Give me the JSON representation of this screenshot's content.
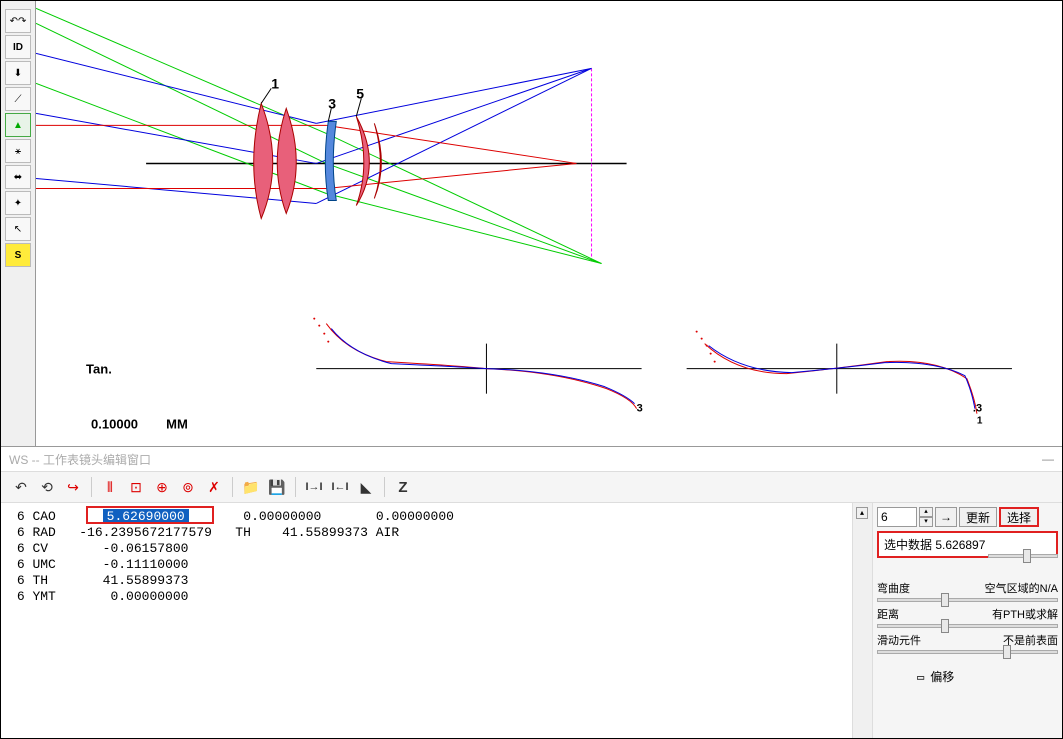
{
  "top_toolbar": {
    "icons": [
      "↶↷",
      "ID",
      "⬇",
      "⟋",
      "▲",
      "⚹",
      "⬌",
      "✦",
      "↖",
      "S"
    ]
  },
  "diagram": {
    "labels": {
      "lens1": "1",
      "lens3": "3",
      "lens5": "5"
    },
    "tan_label": "Tan.",
    "scale": "0.10000",
    "unit": "MM",
    "curve_label_right": "3",
    "curve_label_right2": ".3",
    "curve_label_right3": "1"
  },
  "ws_title": "WS -- 工作表镜头编辑窗口",
  "ws_toolbar_icons": [
    "↶",
    "⟲",
    "↪",
    "⫴",
    "⊡",
    "⊕",
    "⊚",
    "✗",
    "",
    "📁",
    "💾",
    "",
    "I→I",
    "I←I",
    "◣",
    "",
    "Z"
  ],
  "data_rows": [
    {
      "n": "6",
      "key": "CAO",
      "v1_hl": "5.62690000",
      "v2": "0.00000000",
      "v3": "0.00000000"
    },
    {
      "n": "6",
      "key": "RAD",
      "v1": "-16.2395672177579",
      "mid": "TH",
      "v2": "41.55899373",
      "v3": "AIR"
    },
    {
      "n": "6",
      "key": "CV",
      "v1": "-0.06157800"
    },
    {
      "n": "6",
      "key": "UMC",
      "v1": "-0.11110000"
    },
    {
      "n": "6",
      "key": "TH",
      "v1": "41.55899373"
    },
    {
      "n": "6",
      "key": "YMT",
      "v1": "0.00000000"
    }
  ],
  "right_panel": {
    "num_value": "6",
    "goto_btn": "→",
    "update_btn": "更新",
    "select_btn": "选择",
    "selected_label": "选中数据 5.626897",
    "sliders": [
      {
        "left": "弯曲度",
        "right": "空气区域的N/A",
        "pos": 35
      },
      {
        "left": "距离",
        "right": "有PTH或求解",
        "pos": 35
      },
      {
        "left": "滑动元件",
        "right": "不是前表面",
        "pos": 70
      }
    ],
    "offset_label": "偏移"
  }
}
